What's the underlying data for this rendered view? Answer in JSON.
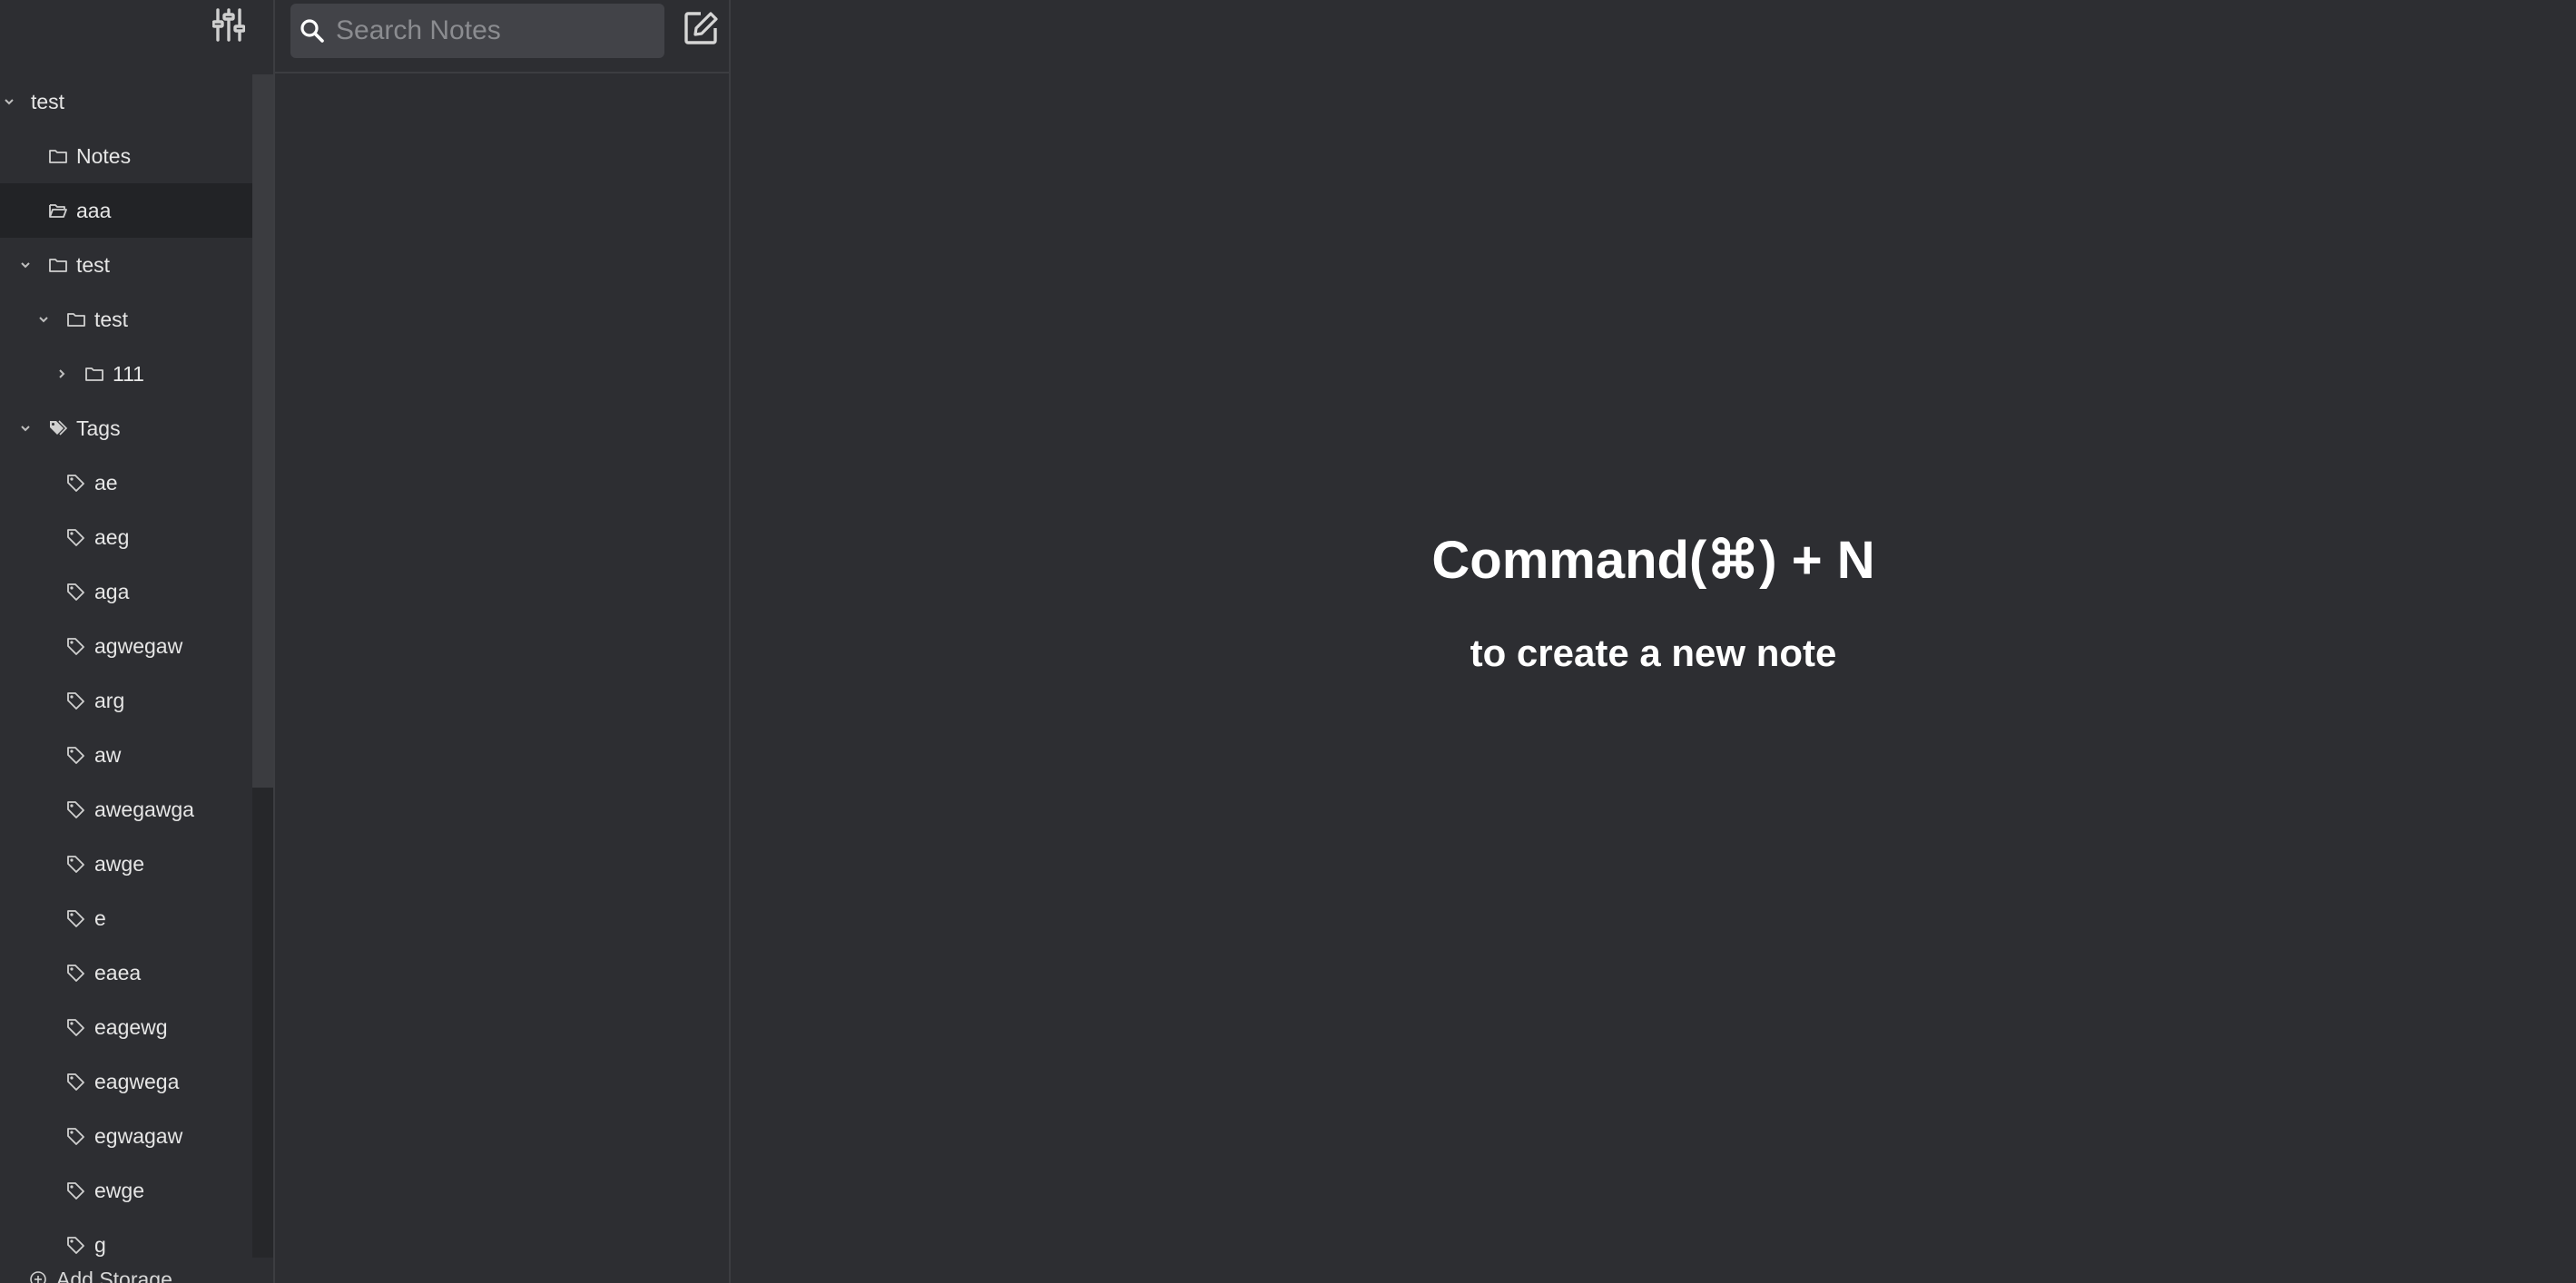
{
  "sidebar": {
    "storage": {
      "label": "test"
    },
    "folders": [
      {
        "label": "Notes",
        "selected": false
      },
      {
        "label": "aaa",
        "selected": true
      },
      {
        "label": "test"
      },
      {
        "label": "test"
      },
      {
        "label": "111"
      }
    ],
    "tags_header": {
      "label": "Tags"
    },
    "tags": [
      "ae",
      "aeg",
      "aga",
      "agwegaw",
      "arg",
      "aw",
      "awegawga",
      "awge",
      "e",
      "eaea",
      "eagewg",
      "eagwega",
      "egwagaw",
      "ewge",
      "g"
    ],
    "add_storage_label": "Add Storage"
  },
  "notelist": {
    "search": {
      "placeholder": "Search Notes",
      "value": ""
    }
  },
  "main": {
    "empty_title": "Command(⌘) + N",
    "empty_subtitle": "to create a new note"
  },
  "colors": {
    "background": "#2d2e32",
    "sidebar_selected": "#222326",
    "search_bg": "#424348",
    "divider": "#3c3d41",
    "icon": "#d0d0d0"
  },
  "icons": {
    "settings": "sliders-icon",
    "search": "search-icon",
    "new_note": "compose-icon",
    "folder": "folder-icon",
    "folder_open": "folder-open-icon",
    "tag": "tag-icon",
    "tags": "tags-icon",
    "add": "plus-circle-icon"
  }
}
